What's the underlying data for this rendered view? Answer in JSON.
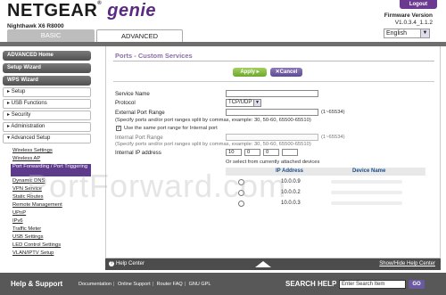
{
  "header": {
    "brand": "NETGEAR",
    "brand_suffix": "genie",
    "brand_reg": "®",
    "model": "Nighthawk X6 R8000",
    "logout": "Logout",
    "firmware_label": "Firmware Version",
    "firmware_value": "V1.0.3.4_1.1.2",
    "language": "English"
  },
  "tabs": {
    "basic": "BASIC",
    "advanced": "ADVANCED"
  },
  "sidebar": {
    "advanced_home": "ADVANCED Home",
    "setup_wizard": "Setup Wizard",
    "wps_wizard": "WPS Wizard",
    "groups": [
      "Setup",
      "USB Functions",
      "Security",
      "Administration"
    ],
    "advanced_setup": "Advanced Setup",
    "sub_items": [
      "Wireless Settings",
      "Wireless AP",
      "Port Forwarding / Port Triggering",
      "Dynamic DNS",
      "VPN Service",
      "Static Routes",
      "Remote Management",
      "UPnP",
      "IPv6",
      "Traffic Meter",
      "USB Settings",
      "LED Control Settings",
      "VLAN/IPTV Setup"
    ]
  },
  "main": {
    "title": "Ports - Custom Services",
    "apply": "Apply",
    "cancel": "Cancel",
    "service_name_label": "Service Name",
    "protocol_label": "Protocol",
    "protocol_value": "TCP/UDP",
    "ext_port_label": "External Port Range",
    "range_hint": "(1~65534)",
    "ext_hint": "(Specify ports and/or port ranges split by commas, example: 30, 50-60, 65500-65510)",
    "same_port_label": "Use the same port range for Internal port",
    "int_port_label": "Internal Port Range",
    "int_hint": "(Specify ports and/or port ranges split by commas, example: 30, 50-60, 65500-65510)",
    "internal_ip_label": "Internal IP address",
    "ip_octets": [
      "10",
      "0",
      "0",
      ""
    ],
    "select_hint": "Or select from currently attached devices",
    "table_headers": {
      "ip": "IP Address",
      "device": "Device Name"
    },
    "devices": [
      {
        "ip": "10.0.0.9"
      },
      {
        "ip": "10.0.0.2"
      },
      {
        "ip": "10.0.0.3"
      }
    ]
  },
  "watermark": "PortForward.com",
  "help": {
    "center": "Help Center",
    "toggle": "Show/Hide Help Center"
  },
  "footer": {
    "title": "Help & Support",
    "links": [
      "Documentation",
      "Online Support",
      "Router FAQ",
      "GNU GPL"
    ],
    "search_label": "SEARCH HELP",
    "search_placeholder": "Enter Search Item",
    "go": "GO"
  }
}
